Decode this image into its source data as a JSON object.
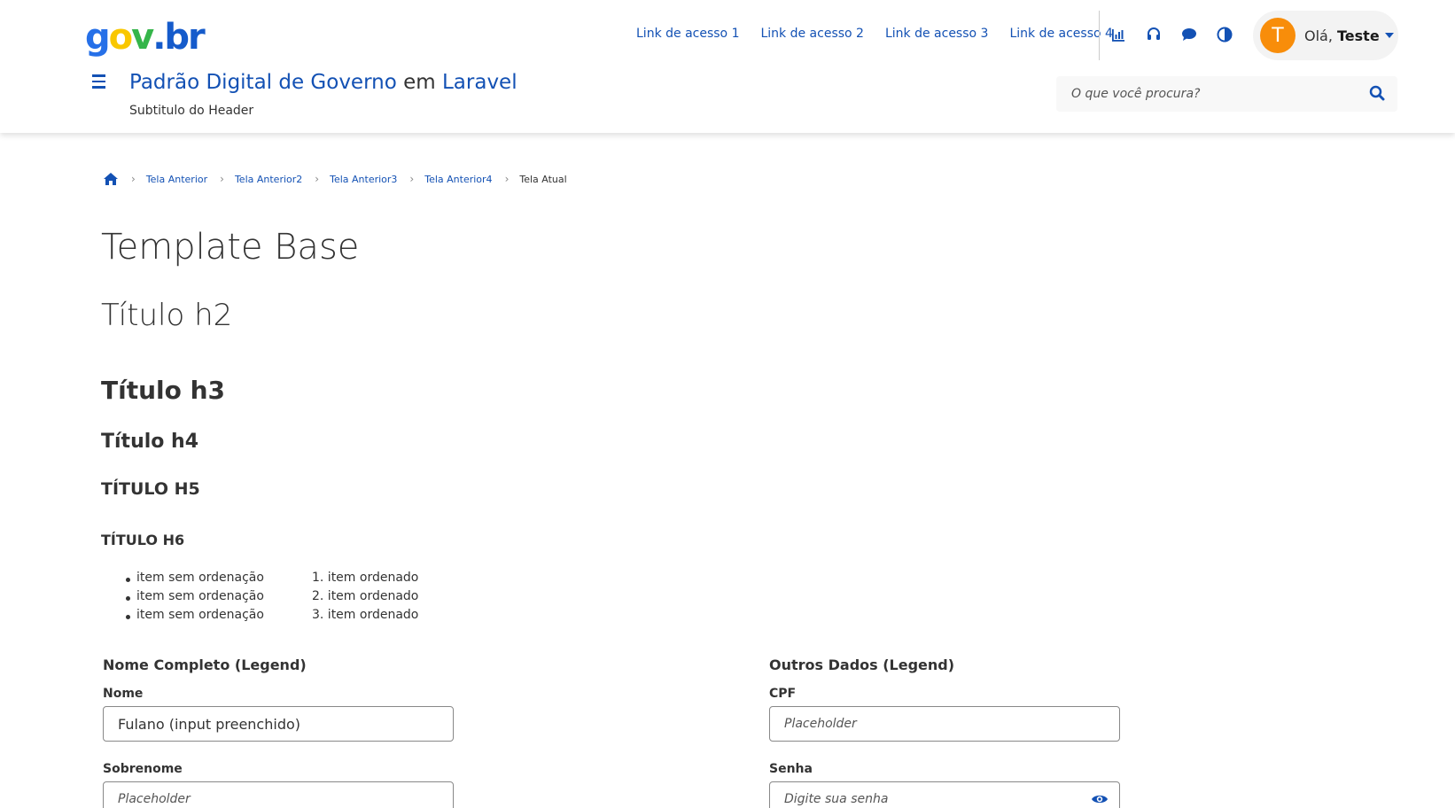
{
  "header": {
    "logo": {
      "g": "g",
      "o": "o",
      "v": "v",
      "dot": ".",
      "br": "br"
    },
    "access_links": [
      "Link de acesso 1",
      "Link de acesso 2",
      "Link de acesso 3",
      "Link de acesso 4"
    ],
    "tools": [
      "chart-icon",
      "headset-icon",
      "chat-icon",
      "contrast-icon"
    ],
    "user": {
      "initial": "T",
      "greeting": "Olá, ",
      "name": "Teste"
    },
    "title": {
      "part1": "Padrão Digital de Governo ",
      "em": "em",
      "part2": " Laravel"
    },
    "subtitle": "Subtitulo do Header",
    "search_placeholder": "O que você procura?"
  },
  "breadcrumb": {
    "items": [
      "Tela Anterior",
      "Tela Anterior2",
      "Tela Anterior3",
      "Tela Anterior4"
    ],
    "current": "Tela Atual"
  },
  "headings": {
    "h1": "Template Base",
    "h2": "Título h2",
    "h3": "Título h3",
    "h4": "Título h4",
    "h5": "TÍTULO H5",
    "h6": "TÍTULO H6"
  },
  "lists": {
    "unordered": [
      "item sem ordenação",
      "item sem ordenação",
      "item sem ordenação"
    ],
    "ordered": [
      "1. item ordenado",
      "2. item ordenado",
      "3. item ordenado"
    ]
  },
  "form": {
    "left": {
      "legend": "Nome Completo (Legend)",
      "nome_label": "Nome",
      "nome_value": "Fulano (input preenchido)",
      "sobrenome_label": "Sobrenome",
      "sobrenome_placeholder": "Placeholder"
    },
    "right": {
      "legend": "Outros Dados (Legend)",
      "cpf_label": "CPF",
      "cpf_placeholder": "Placeholder",
      "senha_label": "Senha",
      "senha_placeholder": "Digite sua senha"
    }
  },
  "colors": {
    "primary": "#1351b4",
    "avatar": "#f88d0a"
  }
}
